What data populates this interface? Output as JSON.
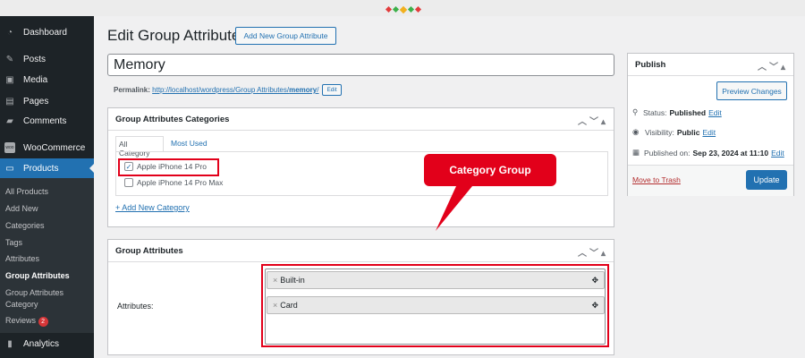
{
  "sidebar": {
    "items": [
      {
        "label": "Dashboard",
        "icon": "dashboard-icon"
      },
      {
        "label": "Posts",
        "icon": "pin-icon"
      },
      {
        "label": "Media",
        "icon": "media-icon"
      },
      {
        "label": "Pages",
        "icon": "pages-icon"
      },
      {
        "label": "Comments",
        "icon": "comment-icon"
      },
      {
        "label": "WooCommerce",
        "icon": "woo-icon"
      },
      {
        "label": "Products",
        "icon": "archive-icon"
      },
      {
        "label": "Analytics",
        "icon": "chart-icon"
      }
    ],
    "submenu": [
      "All Products",
      "Add New",
      "Categories",
      "Tags",
      "Attributes",
      "Group Attributes",
      "Group Attributes",
      "Category",
      "Reviews"
    ],
    "reviews_badge": "2"
  },
  "header": {
    "title": "Edit Group Attribute",
    "add_new": "Add New Group Attribute"
  },
  "post": {
    "title": "Memory",
    "permalink_label": "Permalink:",
    "permalink_url": "http://localhost/wordpress/Group Attributes/",
    "permalink_slug": "memory",
    "permalink_trail": "/",
    "edit": "Edit"
  },
  "categories": {
    "title": "Group Attributes Categories",
    "tabs": [
      "All Category",
      "Most Used"
    ],
    "items": [
      {
        "label": "Apple iPhone 14 Pro",
        "checked": true
      },
      {
        "label": "Apple iPhone 14 Pro Max",
        "checked": false
      }
    ],
    "add_new": "+ Add New Category"
  },
  "attributes": {
    "title": "Group Attributes",
    "label": "Attributes:",
    "tags": [
      "Built-in",
      "Card"
    ]
  },
  "callout": "Category Group",
  "publish": {
    "title": "Publish",
    "preview": "Preview Changes",
    "status_label": "Status:",
    "status": "Published",
    "visibility_label": "Visibility:",
    "visibility": "Public",
    "published_label": "Published on:",
    "published": "Sep 23, 2024 at 11:10",
    "edit": "Edit",
    "trash": "Move to Trash",
    "update": "Update"
  },
  "colors": {
    "accent": "#2271b1",
    "highlight": "#e2001a"
  }
}
